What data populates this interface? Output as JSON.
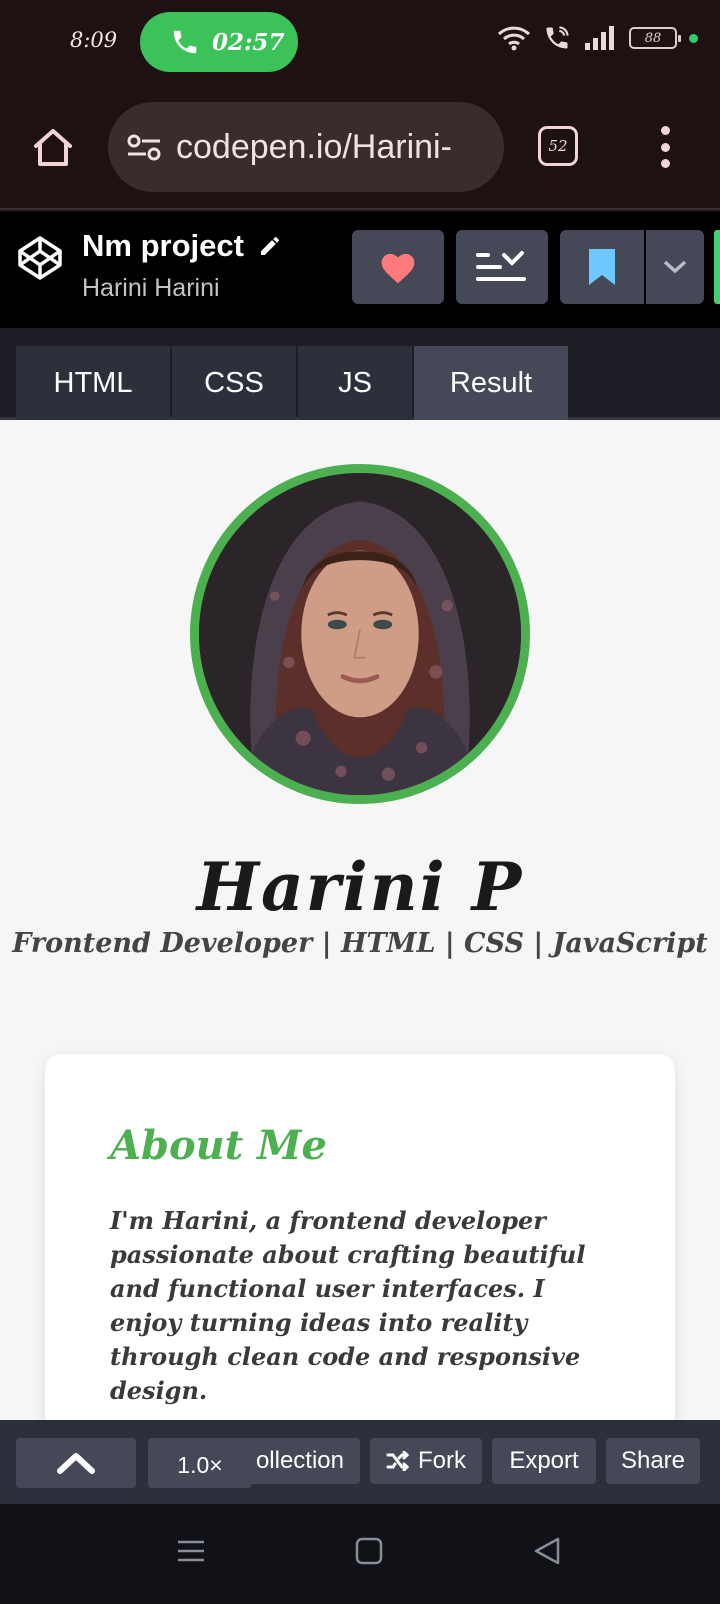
{
  "status_bar": {
    "time": "8:09",
    "call_timer": "02:57",
    "battery": "88"
  },
  "browser": {
    "url": "codepen.io/Harini-",
    "tab_count": "52"
  },
  "codepen": {
    "project_title": "Nm project",
    "author": "Harini Harini",
    "tabs": [
      "HTML",
      "CSS",
      "JS",
      "Result"
    ],
    "active_tab": "Result"
  },
  "result": {
    "name": "Harini P",
    "subtitle": "Frontend Developer | HTML | CSS | JavaScript",
    "about_title": "About Me",
    "about_text": "I'm Harini, a frontend developer passionate about crafting beautiful and functional user interfaces. I enjoy turning ideas into reality through clean code and responsive design.",
    "accent_color": "#4caf50"
  },
  "toolbar": {
    "collection_label": "ollection",
    "zoom": "1.0×",
    "fork_label": "Fork",
    "export_label": "Export",
    "share_label": "Share"
  }
}
